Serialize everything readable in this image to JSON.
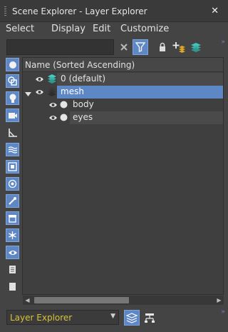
{
  "window": {
    "title": "Scene Explorer - Layer Explorer",
    "close_glyph": "✕"
  },
  "menu": [
    "Select",
    "Display",
    "Edit",
    "Customize"
  ],
  "toolbar": {
    "search_value": "",
    "search_placeholder": "",
    "icons": [
      "clear-filter-icon",
      "funnel-filter-icon",
      "lock-icon",
      "add-to-layer-icon",
      "layers-icon"
    ]
  },
  "tree": {
    "header": "Name (Sorted Ascending)",
    "rows": [
      {
        "label": "0 (default)",
        "visible": true,
        "level": 0,
        "selected": false,
        "type": "layer"
      },
      {
        "label": "mesh",
        "visible": true,
        "level": 0,
        "selected": true,
        "expanded": true,
        "type": "layer"
      },
      {
        "label": "body",
        "visible": true,
        "level": 1,
        "selected": false,
        "type": "object"
      },
      {
        "label": "eyes",
        "visible": true,
        "level": 1,
        "selected": false,
        "type": "object"
      }
    ]
  },
  "leftbar_icons": [
    "geometry-icon",
    "shapes-icon",
    "lights-icon",
    "cameras-icon",
    "helpers-icon",
    "spacewarps-icon",
    "groups-icon",
    "xrefs-icon",
    "bones-icon",
    "containers-icon",
    "frozen-icon",
    "hidden-icon",
    "display-all-icon",
    "display-none-icon"
  ],
  "bottom": {
    "explorer_select_value": "Layer Explorer"
  },
  "colors": {
    "accent": "#5e87c6",
    "selected_row": "#5e87c6",
    "explorer_text": "#d8c338",
    "layer_icon": "#3fc1b8"
  }
}
